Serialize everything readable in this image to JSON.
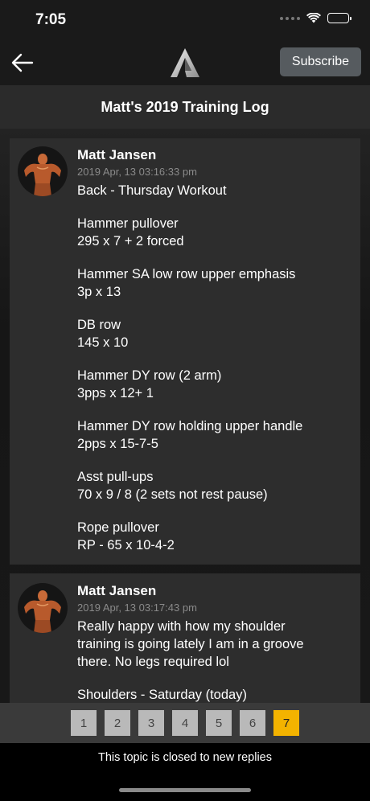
{
  "status": {
    "time": "7:05"
  },
  "nav": {
    "subscribe_label": "Subscribe"
  },
  "page": {
    "title": "Matt's 2019 Training Log"
  },
  "posts": [
    {
      "author": "Matt Jansen",
      "date": "2019 Apr, 13 03:16:33 pm",
      "paragraphs": [
        "Back - Thursday Workout",
        "Hammer pullover\n295 x 7 + 2 forced",
        "Hammer SA low row upper emphasis\n3p x 13",
        "DB row\n145 x 10",
        "Hammer DY row (2 arm)\n3pps x 12+ 1",
        "Hammer DY row holding upper handle\n2pps x 15-7-5",
        "Asst pull-ups\n70 x 9 / 8 (2 sets not rest pause)",
        "Rope pullover\nRP - 65 x 10-4-2"
      ]
    },
    {
      "author": "Matt Jansen",
      "date": "2019 Apr, 13 03:17:43 pm",
      "paragraphs": [
        "Really happy with how my shoulder training is going lately I am in a groove there. No legs required lol",
        "Shoulders - Saturday (today)"
      ]
    }
  ],
  "pagination": {
    "pages": [
      "1",
      "2",
      "3",
      "4",
      "5",
      "6",
      "7"
    ],
    "active_page": "7"
  },
  "footer": {
    "closed_text": "This topic is closed to new replies"
  }
}
